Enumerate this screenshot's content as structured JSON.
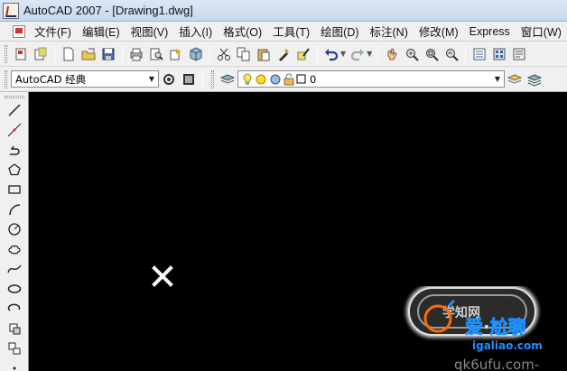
{
  "window": {
    "title": "AutoCAD 2007 - [Drawing1.dwg]"
  },
  "menu": {
    "items": [
      "文件(F)",
      "编辑(E)",
      "视图(V)",
      "插入(I)",
      "格式(O)",
      "工具(T)",
      "绘图(D)",
      "标注(N)",
      "修改(M)",
      "Express",
      "窗口(W)"
    ]
  },
  "toolbar": {
    "workspace": "AutoCAD 经典",
    "layer": "0"
  },
  "standard_toolbar_icons": [
    "new-icon",
    "open-icon",
    "save-icon",
    "plot-icon",
    "plot-preview-icon",
    "publish-icon",
    "3d-dwf-icon",
    "cut-icon",
    "copy-icon",
    "paste-icon",
    "match-properties-icon",
    "block-editor-icon",
    "undo-icon",
    "redo-icon",
    "pan-icon",
    "zoom-realtime-icon",
    "zoom-window-icon",
    "zoom-previous-icon",
    "properties-icon",
    "design-center-icon",
    "tool-palettes-icon"
  ],
  "draw_toolbar_icons": [
    "line-icon",
    "construction-line-icon",
    "polyline-icon",
    "polygon-icon",
    "rectangle-icon",
    "arc-icon",
    "circle-icon",
    "revision-cloud-icon",
    "spline-icon",
    "ellipse-icon",
    "ellipse-arc-icon",
    "insert-block-icon",
    "make-block-icon",
    "point-icon"
  ],
  "watermark": {
    "brand": "爱·尬聊",
    "url": "igaliao.com",
    "badge": "学知网",
    "bottom": "qk6ufu.com-"
  },
  "colors": {
    "canvas": "#000000",
    "title_bar": "#d5e3f3",
    "ui_bg": "#f0f0f0",
    "cursor": "#ffffff",
    "watermark_accent": "#ff6a00"
  }
}
